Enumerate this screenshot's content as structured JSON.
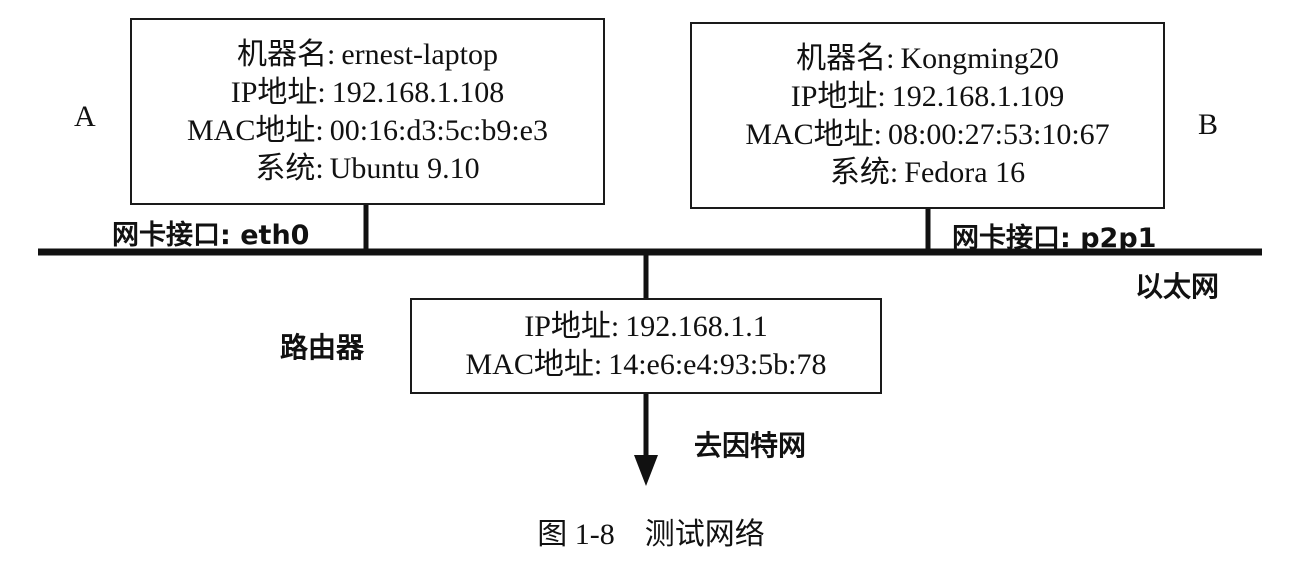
{
  "host_a": {
    "label": "A",
    "name_key": "机器名:",
    "name_val": "ernest-laptop",
    "ip_key": "IP地址:",
    "ip_val": "192.168.1.108",
    "mac_key": "MAC地址:",
    "mac_val": "00:16:d3:5c:b9:e3",
    "os_key": "系统:",
    "os_val": "Ubuntu 9.10",
    "iface_key": "网卡接口:",
    "iface_val": "eth0"
  },
  "host_b": {
    "label": "B",
    "name_key": "机器名:",
    "name_val": "Kongming20",
    "ip_key": "IP地址:",
    "ip_val": "192.168.1.109",
    "mac_key": "MAC地址:",
    "mac_val": "08:00:27:53:10:67",
    "os_key": "系统:",
    "os_val": "Fedora 16",
    "iface_key": "网卡接口:",
    "iface_val": "p2p1"
  },
  "ethernet_label": "以太网",
  "router": {
    "label": "路由器",
    "ip_key": "IP地址:",
    "ip_val": "192.168.1.1",
    "mac_key": "MAC地址:",
    "mac_val": "14:e6:e4:93:5b:78"
  },
  "internet_label": "去因特网",
  "caption": "图 1-8　测试网络"
}
